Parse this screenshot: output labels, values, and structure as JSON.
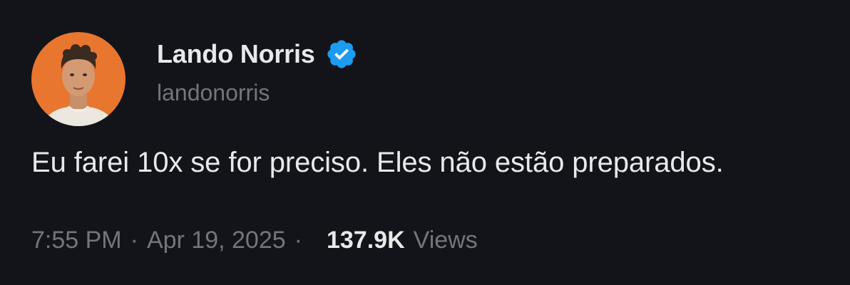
{
  "author": {
    "display_name": "Lando Norris",
    "handle": "landonorris",
    "avatar_icon": "profile-photo",
    "verified_icon": "verified-badge-icon",
    "verified_color": "#1d9bf0"
  },
  "tweet": {
    "text": "Eu farei 10x se for preciso. Eles não estão preparados.",
    "time": "7:55 PM",
    "separator": "·",
    "date": "Apr 19, 2025",
    "views_count": "137.9K",
    "views_label": "Views"
  },
  "colors": {
    "background": "#121419",
    "primary_text": "#e7e9ea",
    "secondary_text": "#71767b",
    "avatar_background": "#e8762f"
  }
}
